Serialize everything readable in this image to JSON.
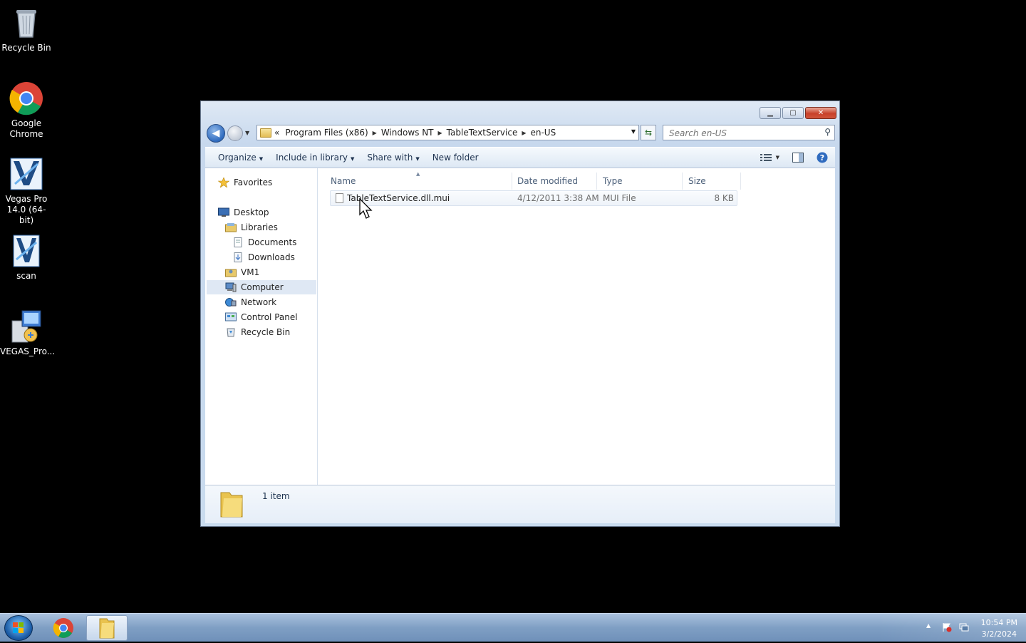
{
  "desktop": {
    "icons": [
      {
        "label": "Recycle Bin"
      },
      {
        "label": "Google Chrome"
      },
      {
        "label": "Vegas Pro 14.0 (64-bit)"
      },
      {
        "label": "scan"
      },
      {
        "label": "VEGAS_Pro..."
      }
    ]
  },
  "window": {
    "address": {
      "overflow": "«",
      "segments": [
        "Program Files (x86)",
        "Windows NT",
        "TableTextService",
        "en-US"
      ]
    },
    "search_placeholder": "Search en-US",
    "toolbar": {
      "organize": "Organize",
      "include_in_library": "Include in library",
      "share_with": "Share with",
      "new_folder": "New folder"
    },
    "nav": {
      "favorites": "Favorites",
      "desktop": "Desktop",
      "libraries": "Libraries",
      "documents": "Documents",
      "downloads": "Downloads",
      "vm1": "VM1",
      "computer": "Computer",
      "network": "Network",
      "control_panel": "Control Panel",
      "recycle_bin": "Recycle Bin"
    },
    "columns": {
      "name": "Name",
      "date_modified": "Date modified",
      "type": "Type",
      "size": "Size"
    },
    "files": [
      {
        "name": "TableTextService.dll.mui",
        "date_modified": "4/12/2011 3:38 AM",
        "type": "MUI File",
        "size": "8 KB"
      }
    ],
    "status": {
      "item_count": "1 item"
    }
  },
  "taskbar": {
    "clock": {
      "time": "10:54 PM",
      "date": "3/2/2024"
    }
  },
  "colors": {
    "accent": "#2f6bbf",
    "close_button": "#c8412a"
  }
}
